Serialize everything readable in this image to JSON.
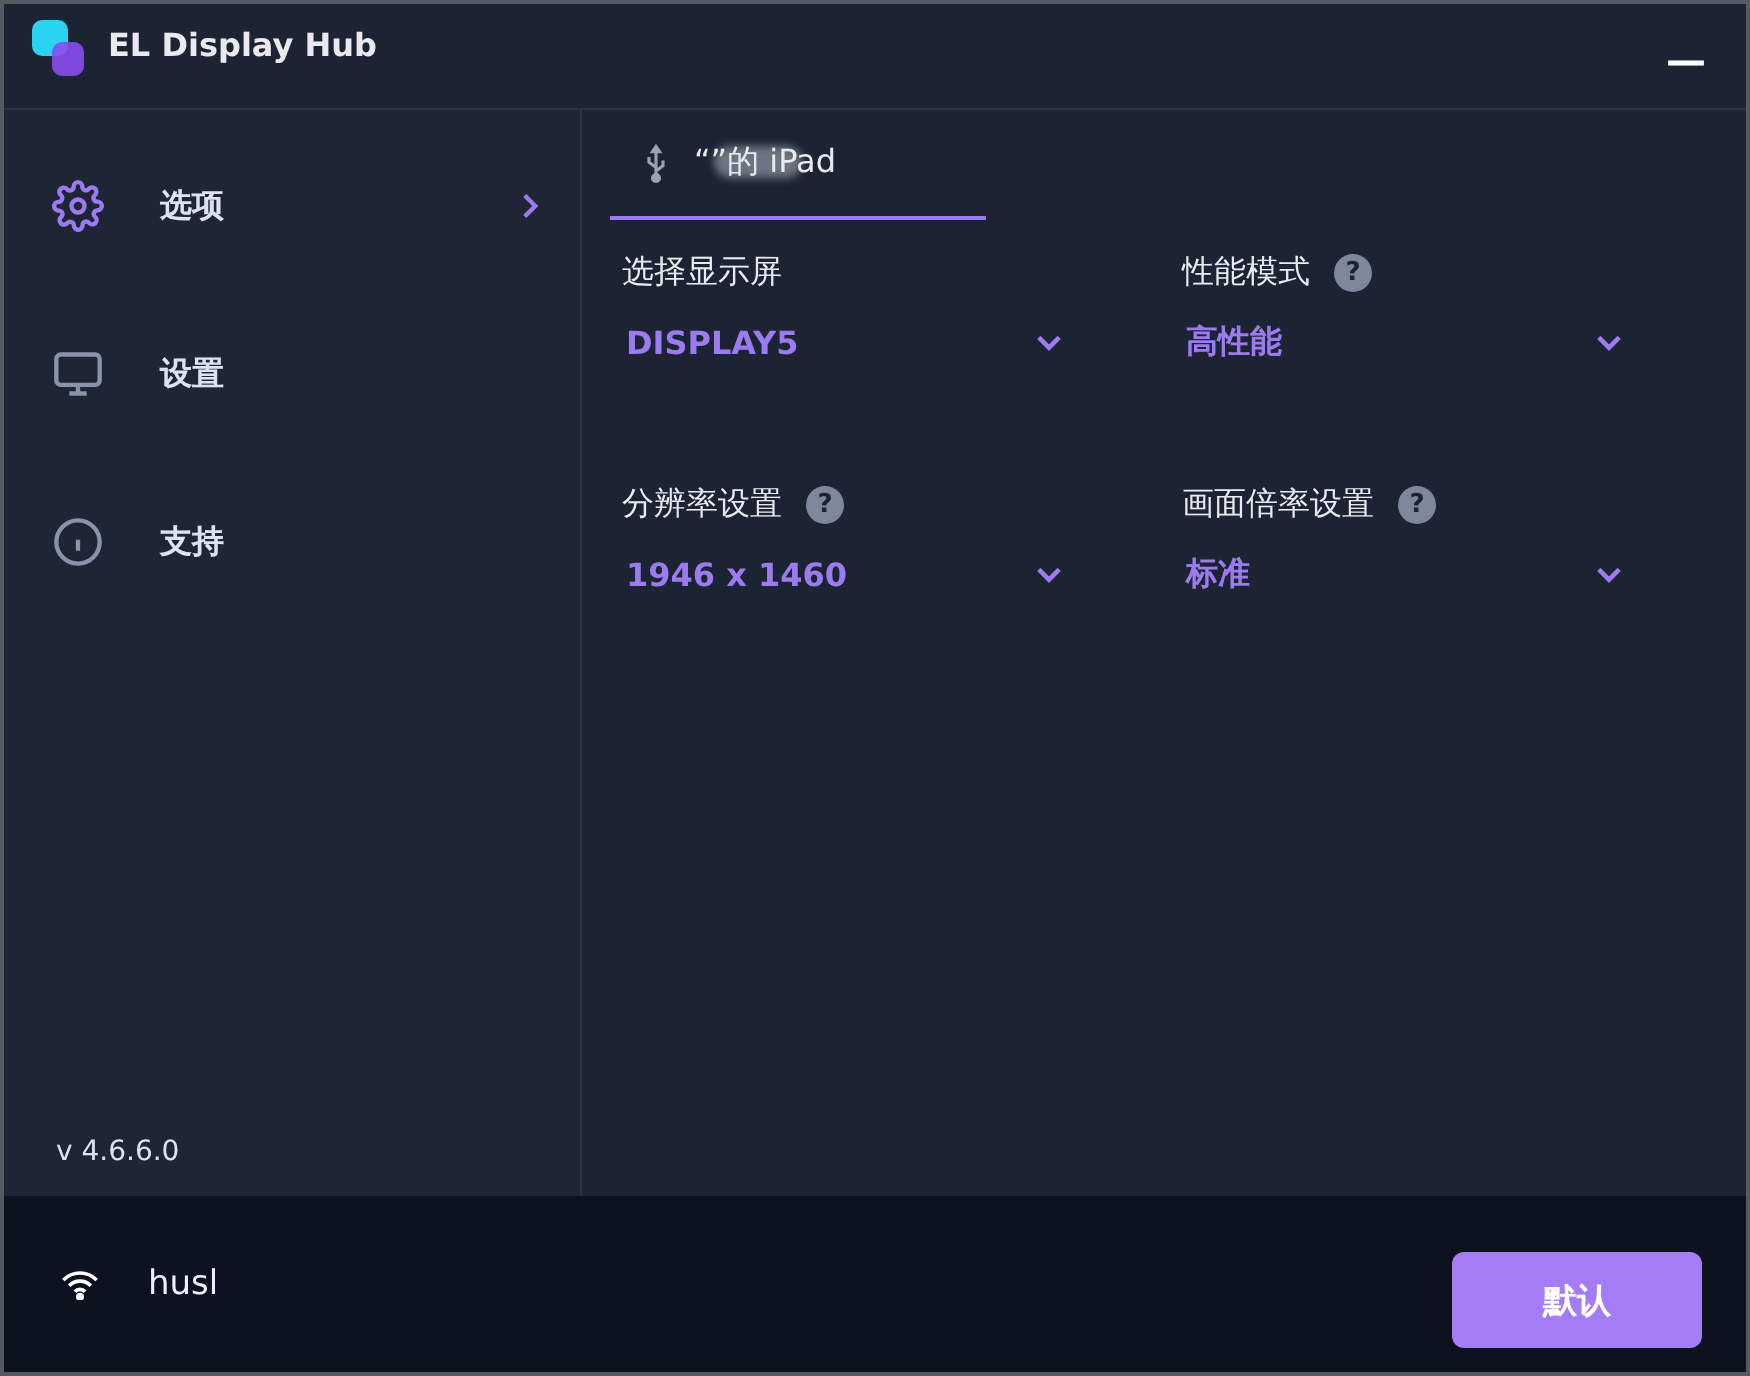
{
  "window": {
    "title": "EL Display Hub",
    "minimize": "—"
  },
  "sidebar": {
    "items": [
      {
        "label": "选项",
        "selected": true
      },
      {
        "label": "设置",
        "selected": false
      },
      {
        "label": "支持",
        "selected": false
      }
    ],
    "version": "v 4.6.6.0"
  },
  "tabs": [
    {
      "label": "“”的 iPad",
      "redacted": true,
      "selected": true
    }
  ],
  "settings": [
    {
      "label": "选择显示屏",
      "value": "DISPLAY5"
    },
    {
      "label": "性能模式",
      "help": "?",
      "value": "高性能"
    },
    {
      "label": "分辨率设置",
      "help": "?",
      "value": "1946 x 1460"
    },
    {
      "label": "画面倍率设置",
      "help": "?",
      "value": "标准"
    }
  ],
  "footer": {
    "network": "husl",
    "button": "默认"
  }
}
